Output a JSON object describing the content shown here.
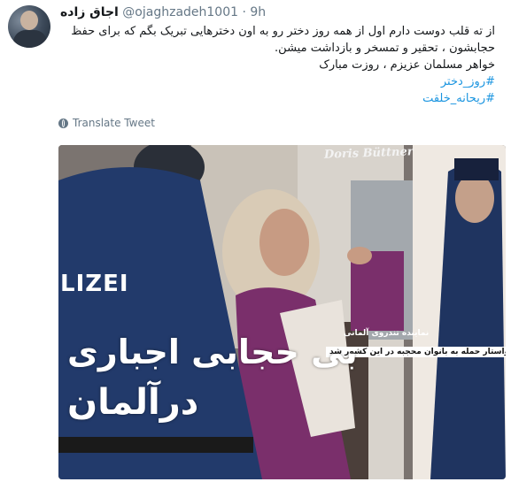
{
  "tweet": {
    "display_name": "اجاق زاده",
    "handle": "@ojaghzadeh1001",
    "separator": "·",
    "time": "9h",
    "text_lines": [
      "از ته قلب دوست دارم اول از همه روز دختر رو به اون دخترهایی تبریک بگم که برای حفظ",
      "حجابشون ، تحقیر و تمسخر و بازداشت میشن.",
      "خواهر مسلمان عزیزم ،  روزت مبارک"
    ],
    "hashtags": [
      "#روز_دختر",
      "#ریحانه_خلقت"
    ],
    "translate_label": "Translate Tweet",
    "translate_icon": "globe-icon"
  },
  "media": {
    "overlay_title_line1": "بی حجابی اجباری",
    "overlay_title_line2": "درآلمان",
    "caption_small": "نماینده تندروی آلمانی",
    "caption_box": "خواستار حمله به بانوان محجبه در این کشور شد",
    "police_text": "LIZEI",
    "shop_sign": "Doris Büttner"
  },
  "colors": {
    "link": "#1b95e0",
    "secondary": "#657786",
    "text": "#14171a"
  }
}
